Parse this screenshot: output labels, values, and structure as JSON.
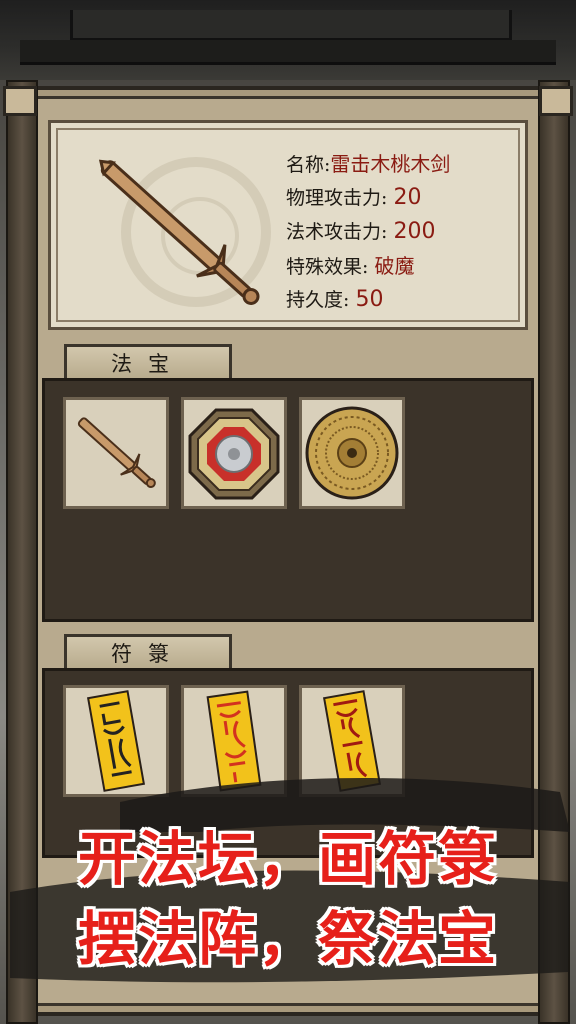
{
  "item_info": {
    "name_label": "名称:",
    "name_value": "雷击木桃木剑",
    "physical_label": "物理攻击力:",
    "physical_value": "20",
    "magic_label": "法术攻击力:",
    "magic_value": "200",
    "effect_label": "特殊效果:",
    "effect_value": "破魔",
    "durability_label": "持久度:",
    "durability_value": "50"
  },
  "sections": {
    "treasures_tab": "法宝",
    "talismans_tab": "符箓"
  },
  "treasures": [
    {
      "icon": "peachwood-sword-icon"
    },
    {
      "icon": "bagua-mirror-icon"
    },
    {
      "icon": "luopan-compass-icon"
    }
  ],
  "talismans": [
    {
      "icon": "talisman-icon"
    },
    {
      "icon": "talisman-icon"
    },
    {
      "icon": "talisman-icon"
    }
  ],
  "slogan": {
    "line1": "开法坛，画符箓",
    "line2": "摆法阵，祭法宝"
  },
  "colors": {
    "accent_red": "#e6201a",
    "value_red": "#8a1b12",
    "talisman_yellow": "#f2c21b"
  }
}
